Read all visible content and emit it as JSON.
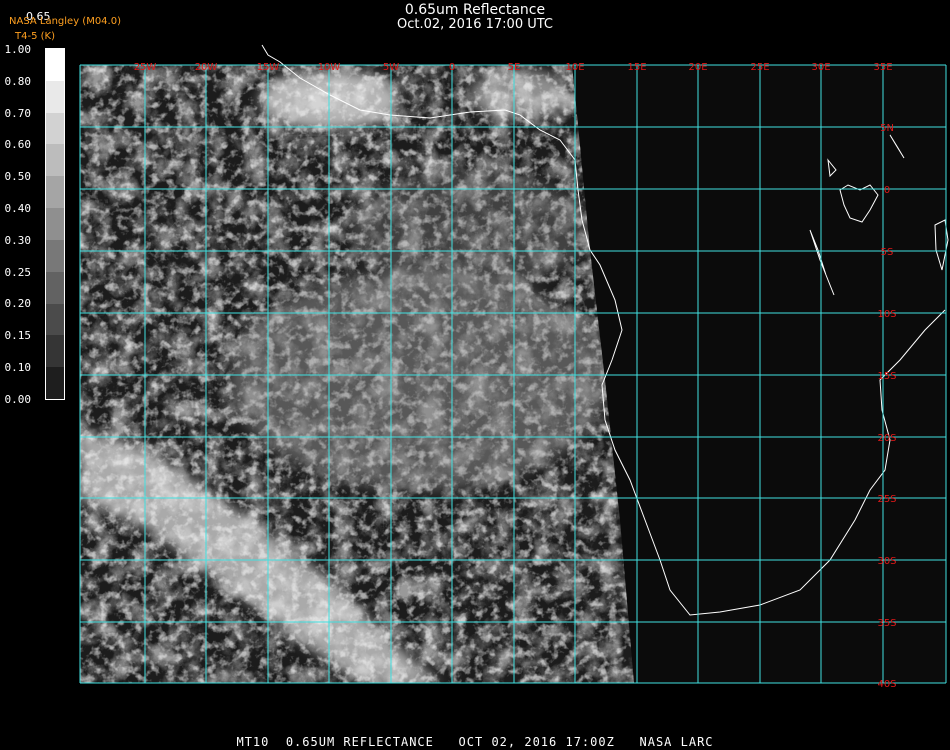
{
  "header": {
    "title": "0.65um Reflectance",
    "subtitle": "Oct.02, 2016 17:00 UTC"
  },
  "colorbar": {
    "label": "0.65",
    "credit": "NASA Langley (M04.0)",
    "channel": "T4-5 (K)",
    "ticks": [
      "1.00",
      "0.80",
      "0.70",
      "0.60",
      "0.50",
      "0.40",
      "0.30",
      "0.25",
      "0.20",
      "0.15",
      "0.10",
      "0.00"
    ]
  },
  "map": {
    "lon_labels": [
      "25W",
      "20W",
      "15W",
      "10W",
      "5W",
      "0",
      "5E",
      "10E",
      "15E",
      "20E",
      "25E",
      "30E",
      "35E"
    ],
    "lat_labels": [
      "5N",
      "0",
      "5S",
      "10S",
      "15S",
      "20S",
      "25S",
      "30S",
      "35S",
      "40S"
    ],
    "grid_color": "#40e0e0",
    "label_color": "#e01818",
    "coast_color": "#ffffff"
  },
  "footer": {
    "text": "MT10  0.65UM REFLECTANCE   OCT 02, 2016 17:00Z   NASA LARC"
  }
}
